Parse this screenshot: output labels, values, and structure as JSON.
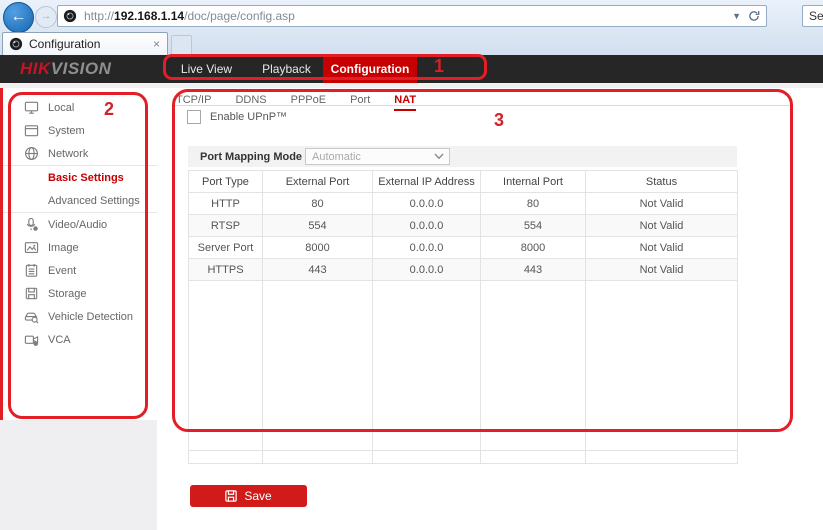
{
  "browser": {
    "back_glyph": "←",
    "forward_glyph": "→",
    "url": {
      "prefix": "http://",
      "host": "192.168.1.14",
      "path": "/doc/page/config.asp"
    },
    "dropdown_glyph": "▼",
    "search_text": "Se",
    "tab": {
      "title": "Configuration",
      "close_glyph": "×"
    }
  },
  "header": {
    "logo": {
      "hik": "HIK",
      "vision": "VISION"
    },
    "nav_tabs": [
      {
        "label": "Live View",
        "active": false
      },
      {
        "label": "Playback",
        "active": false
      },
      {
        "label": "Configuration",
        "active": true
      }
    ]
  },
  "sidebar": {
    "items": [
      {
        "label": "Local",
        "icon": "monitor-icon"
      },
      {
        "label": "System",
        "icon": "window-icon"
      },
      {
        "label": "Network",
        "icon": "globe-icon"
      },
      {
        "divider": true
      },
      {
        "label": "Basic Settings",
        "sub": true,
        "active": true
      },
      {
        "label": "Advanced Settings",
        "sub": true
      },
      {
        "divider": true
      },
      {
        "label": "Video/Audio",
        "icon": "microphone-icon"
      },
      {
        "label": "Image",
        "icon": "image-icon"
      },
      {
        "label": "Event",
        "icon": "calendar-icon"
      },
      {
        "label": "Storage",
        "icon": "floppy-icon"
      },
      {
        "label": "Vehicle Detection",
        "icon": "vehicle-search-icon"
      },
      {
        "label": "VCA",
        "icon": "camera-icon"
      }
    ]
  },
  "content": {
    "tabs": [
      {
        "label": "TCP/IP",
        "active": false
      },
      {
        "label": "DDNS",
        "active": false
      },
      {
        "label": "PPPoE",
        "active": false
      },
      {
        "label": "Port",
        "active": false
      },
      {
        "label": "NAT",
        "active": true
      }
    ],
    "upnp_checkbox_label": "Enable UPnP™",
    "upnp_checked": false,
    "port_mapping": {
      "label": "Port Mapping Mode",
      "value": "Automatic",
      "disabled": true
    },
    "table": {
      "headers": [
        "Port Type",
        "External Port",
        "External IP Address",
        "Internal Port",
        "Status"
      ],
      "rows": [
        [
          "HTTP",
          "80",
          "0.0.0.0",
          "80",
          "Not Valid"
        ],
        [
          "RTSP",
          "554",
          "0.0.0.0",
          "554",
          "Not Valid"
        ],
        [
          "Server Port",
          "8000",
          "0.0.0.0",
          "8000",
          "Not Valid"
        ],
        [
          "HTTPS",
          "443",
          "0.0.0.0",
          "443",
          "Not Valid"
        ]
      ]
    },
    "save_button_label": "Save"
  },
  "annotations": {
    "labels": [
      "1",
      "2",
      "3"
    ]
  },
  "colors": {
    "brand_red": "#c60000",
    "annotation_red": "#e41e26",
    "header_bar": "#262626",
    "save_button_red": "#d11a1a",
    "sidebar_bg": "#efeff1"
  }
}
